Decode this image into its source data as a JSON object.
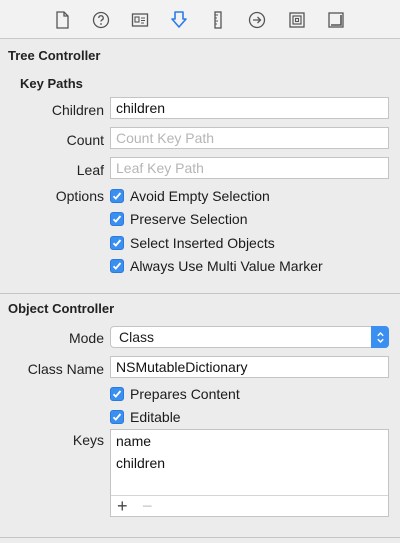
{
  "toolbar": {
    "icons": [
      "file-icon",
      "help-icon",
      "identity-icon",
      "bindings-icon",
      "ruler-icon",
      "connections-icon",
      "effects-icon",
      "size-icon"
    ],
    "active_color": "#2b7ce9"
  },
  "tree_controller": {
    "title": "Tree Controller",
    "key_paths_title": "Key Paths",
    "children_label": "Children",
    "children_value": "children",
    "count_label": "Count",
    "count_placeholder": "Count Key Path",
    "leaf_label": "Leaf",
    "leaf_placeholder": "Leaf Key Path",
    "options_label": "Options",
    "options": [
      {
        "label": "Avoid Empty Selection",
        "checked": true
      },
      {
        "label": "Preserve Selection",
        "checked": true
      },
      {
        "label": "Select Inserted Objects",
        "checked": true
      },
      {
        "label": "Always Use Multi Value Marker",
        "checked": true
      }
    ]
  },
  "object_controller": {
    "title": "Object Controller",
    "mode_label": "Mode",
    "mode_value": "Class",
    "class_name_label": "Class Name",
    "class_name_value": "NSMutableDictionary",
    "prepares_content": {
      "label": "Prepares Content",
      "checked": true
    },
    "editable": {
      "label": "Editable",
      "checked": true
    },
    "keys_label": "Keys",
    "keys": [
      "name",
      "children"
    ],
    "add_symbol": "+",
    "remove_symbol": "−"
  },
  "colors": {
    "accent": "#3a8ff0"
  }
}
